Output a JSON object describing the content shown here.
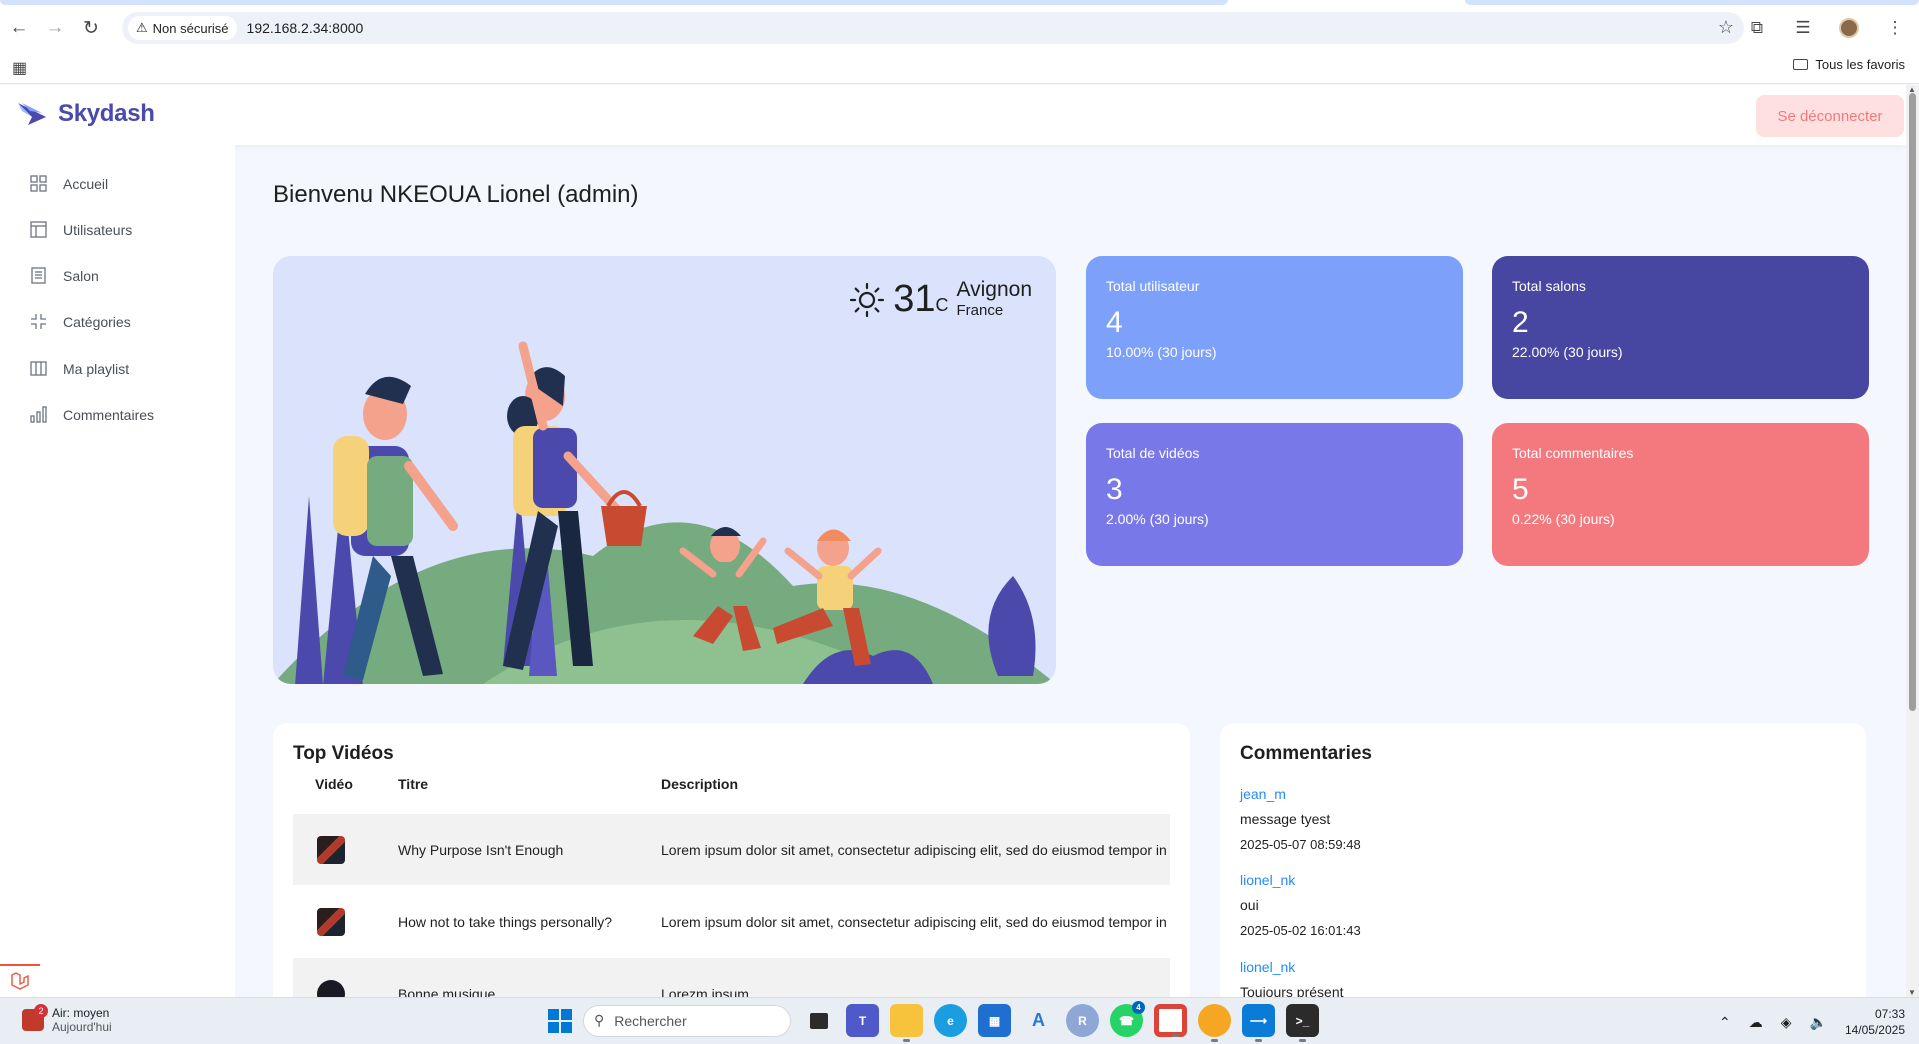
{
  "browser": {
    "security_label": "Non sécurisé",
    "url": "192.168.2.34:8000",
    "bookmarks_folder": "Tous les favoris"
  },
  "app": {
    "brand": "Skydash",
    "logout_label": "Se déconnecter",
    "sidebar": {
      "items": [
        {
          "label": "Accueil",
          "icon": "grid-icon"
        },
        {
          "label": "Utilisateurs",
          "icon": "layout-icon"
        },
        {
          "label": "Salon",
          "icon": "document-icon"
        },
        {
          "label": "Catégories",
          "icon": "collapse-icon"
        },
        {
          "label": "Ma playlist",
          "icon": "columns-icon"
        },
        {
          "label": "Commentaires",
          "icon": "bar-chart-icon"
        }
      ]
    },
    "welcome": "Bienvenu NKEOUA Lionel (admin)",
    "weather": {
      "temp": "31",
      "unit": "C",
      "city": "Avignon",
      "country": "France",
      "icon": "sun-icon"
    },
    "stats": [
      {
        "label": "Total utilisateur",
        "value": "4",
        "sub": "10.00% (30 jours)",
        "color": "#7da0fa"
      },
      {
        "label": "Total salons",
        "value": "2",
        "sub": "22.00% (30 jours)",
        "color": "#4747a1"
      },
      {
        "label": "Total de vidéos",
        "value": "3",
        "sub": "2.00% (30 jours)",
        "color": "#7978e9"
      },
      {
        "label": "Total commentaires",
        "value": "5",
        "sub": "0.22% (30 jours)",
        "color": "#f3797e"
      }
    ],
    "top_videos": {
      "title": "Top Vidéos",
      "columns": [
        "Vidéo",
        "Titre",
        "Description"
      ],
      "rows": [
        {
          "titre": "Why Purpose Isn't Enough",
          "description": "Lorem ipsum dolor sit amet, consectetur adipiscing elit, sed do eiusmod tempor in"
        },
        {
          "titre": "How not to take things personally?",
          "description": "Lorem ipsum dolor sit amet, consectetur adipiscing elit, sed do eiusmod tempor in"
        },
        {
          "titre": "Bonne musique",
          "description": "Lorezm ipsum"
        }
      ]
    },
    "comments": {
      "title": "Commentaries",
      "items": [
        {
          "user": "jean_m",
          "message": "message tyest",
          "date": "2025-05-07 08:59:48"
        },
        {
          "user": "lionel_nk",
          "message": "oui",
          "date": "2025-05-02 16:01:43"
        },
        {
          "user": "lionel_nk",
          "message": "Toujours présent",
          "date": ""
        }
      ]
    }
  },
  "taskbar": {
    "weather_badge": "2",
    "weather_line1": "Air: moyen",
    "weather_line2": "Aujourd'hui",
    "search_placeholder": "Rechercher",
    "whatsapp_badge": "4",
    "r_label": "R",
    "time": "07:33",
    "date": "14/05/2025"
  }
}
